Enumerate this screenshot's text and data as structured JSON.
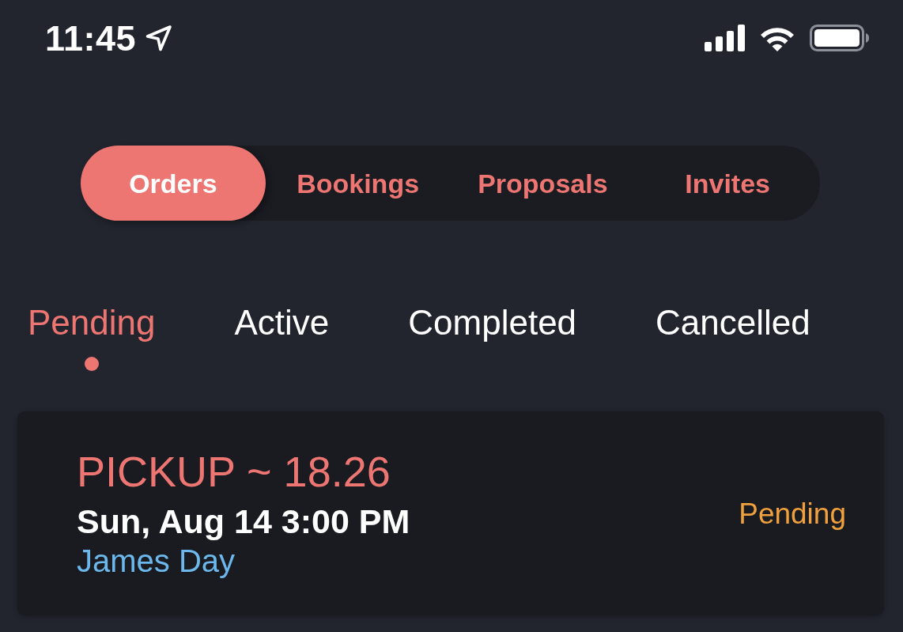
{
  "status_bar": {
    "time": "11:45"
  },
  "segments": [
    {
      "label": "Orders",
      "selected": true
    },
    {
      "label": "Bookings",
      "selected": false
    },
    {
      "label": "Proposals",
      "selected": false
    },
    {
      "label": "Invites",
      "selected": false
    }
  ],
  "status_tabs": [
    {
      "label": "Pending",
      "selected": true
    },
    {
      "label": "Active",
      "selected": false
    },
    {
      "label": "Completed",
      "selected": false
    },
    {
      "label": "Cancelled",
      "selected": false
    }
  ],
  "orders": [
    {
      "title": "PICKUP ~ 18.26",
      "datetime": "Sun, Aug 14 3:00 PM",
      "customer": "James Day",
      "status": "Pending"
    }
  ]
}
